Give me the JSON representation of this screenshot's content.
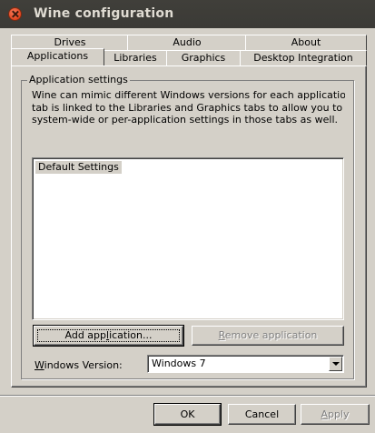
{
  "window": {
    "title": "Wine configuration"
  },
  "tabs_back": [
    "Drives",
    "Audio",
    "About"
  ],
  "tabs_front": [
    "Applications",
    "Libraries",
    "Graphics",
    "Desktop Integration"
  ],
  "group": {
    "title": "Application settings",
    "description": "Wine can mimic different Windows versions for each application.  This\ntab is linked to the Libraries and Graphics tabs to allow you to change\nsystem-wide or per-application settings in those tabs as well."
  },
  "app_list": {
    "items": [
      "Default Settings"
    ],
    "selected": "Default Settings"
  },
  "buttons": {
    "add_pre": "Add app",
    "add_ul": "l",
    "add_post": "ication...",
    "remove_pre": "",
    "remove_ul": "R",
    "remove_post": "emove application",
    "ok": "OK",
    "cancel": "Cancel",
    "apply_pre": "",
    "apply_ul": "A",
    "apply_post": "pply"
  },
  "version": {
    "label_pre": "",
    "label_ul": "W",
    "label_post": "indows Version:",
    "value": "Windows 7"
  }
}
